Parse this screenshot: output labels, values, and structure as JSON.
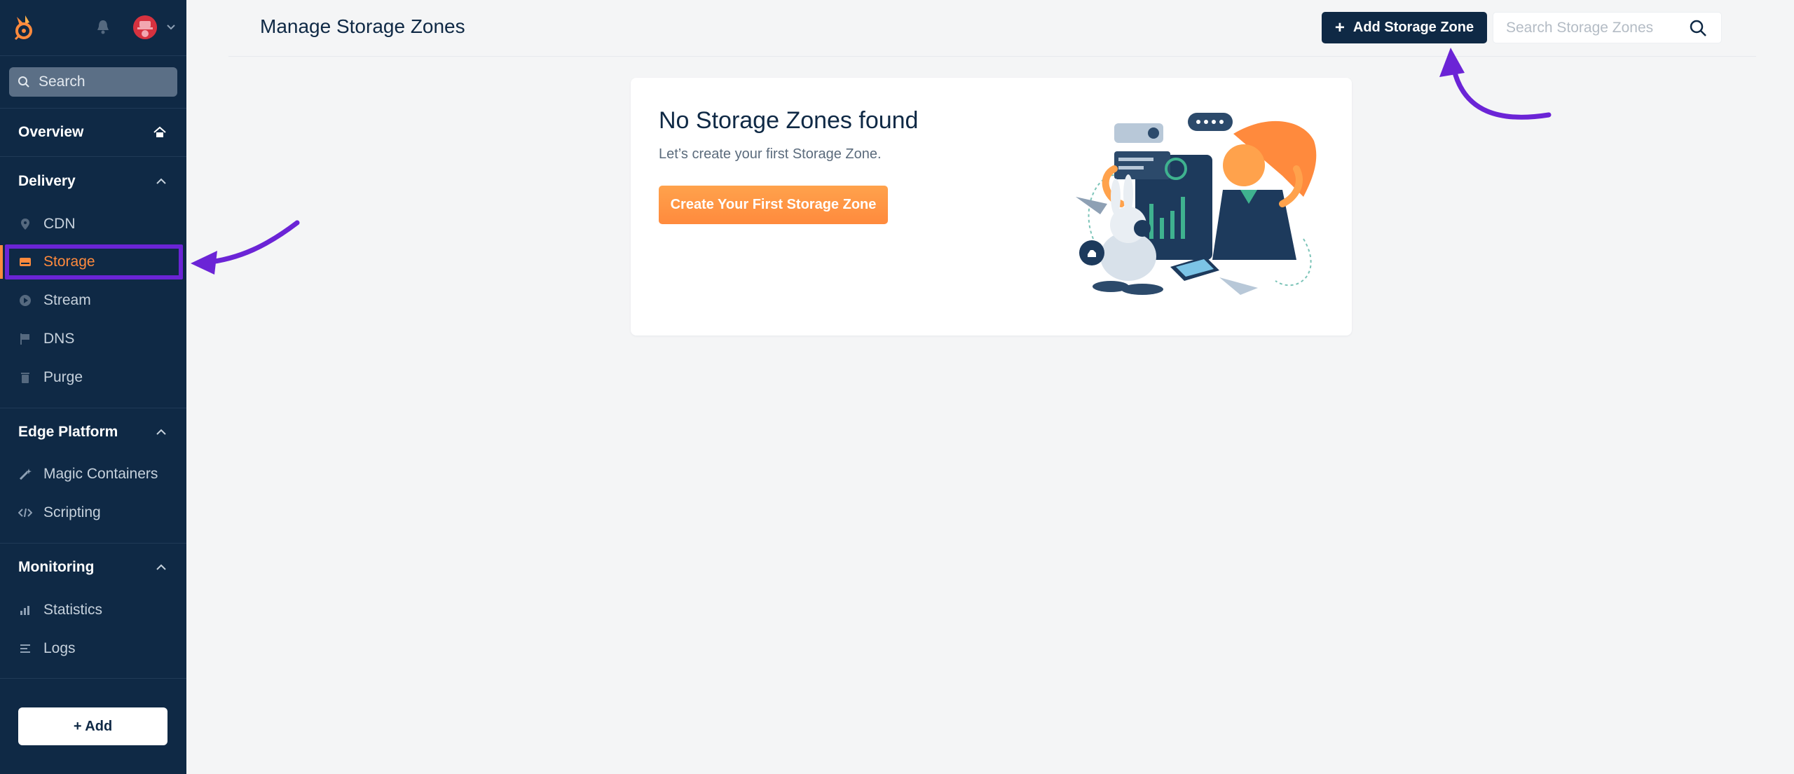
{
  "sidebar": {
    "search_placeholder": "Search",
    "overview": "Overview",
    "sections": {
      "delivery": "Delivery",
      "edge": "Edge Platform",
      "monitoring": "Monitoring"
    },
    "items": {
      "cdn": "CDN",
      "storage": "Storage",
      "stream": "Stream",
      "dns": "DNS",
      "purge": "Purge",
      "magic": "Magic Containers",
      "scripting": "Scripting",
      "statistics": "Statistics",
      "logs": "Logs"
    },
    "add_label": "+ Add"
  },
  "header": {
    "title": "Manage Storage Zones",
    "add_button": "Add Storage Zone",
    "search_placeholder": "Search Storage Zones"
  },
  "empty_state": {
    "title": "No Storage Zones found",
    "subtitle": "Let’s create your first Storage Zone.",
    "button": "Create Your First Storage Zone"
  },
  "colors": {
    "sidebar_bg": "#0f2945",
    "accent": "#ff8a3d",
    "annotation": "#6b24d6"
  }
}
